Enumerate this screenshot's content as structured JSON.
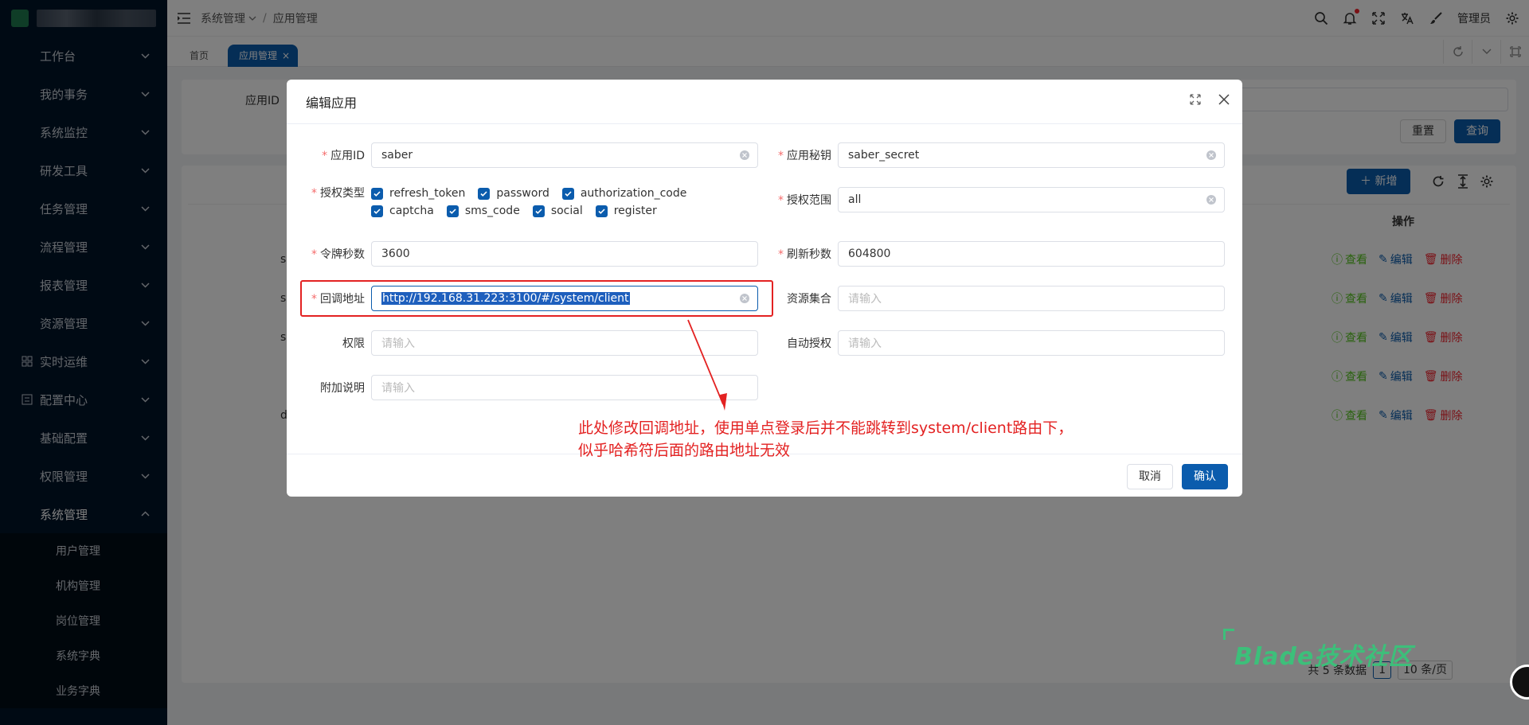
{
  "sidebar": {
    "items": [
      {
        "label": "工作台"
      },
      {
        "label": "我的事务"
      },
      {
        "label": "系统监控"
      },
      {
        "label": "研发工具"
      },
      {
        "label": "任务管理"
      },
      {
        "label": "流程管理"
      },
      {
        "label": "报表管理"
      },
      {
        "label": "资源管理"
      },
      {
        "label": "实时运维"
      },
      {
        "label": "配置中心"
      },
      {
        "label": "基础配置"
      },
      {
        "label": "权限管理"
      },
      {
        "label": "系统管理"
      }
    ],
    "sub_items": [
      "用户管理",
      "机构管理",
      "岗位管理",
      "系统字典",
      "业务字典"
    ]
  },
  "topbar": {
    "breadcrumb": [
      "系统管理",
      "应用管理"
    ],
    "user": "管理员"
  },
  "tabs": [
    "首页",
    "应用管理"
  ],
  "search": {
    "app_id_label": "应用ID",
    "reset_label": "重置",
    "query_label": "查询"
  },
  "toolbar": {
    "add_label": "新增"
  },
  "table": {
    "op_header": "操作",
    "row_first_chars": [
      "s",
      "s",
      "s",
      "",
      "d"
    ],
    "actions": {
      "view": "查看",
      "edit": "编辑",
      "delete": "删除"
    }
  },
  "pagination": {
    "total": "共 5 条数据",
    "page": "1",
    "size": "10 条/页"
  },
  "watermark": "Blade技术社区",
  "dialog": {
    "title": "编辑应用",
    "fields": {
      "client_id": {
        "label": "应用ID",
        "value": "saber"
      },
      "client_secret": {
        "label": "应用秘钥",
        "value": "saber_secret"
      },
      "grant_types": {
        "label": "授权类型",
        "options": [
          "refresh_token",
          "password",
          "authorization_code",
          "captcha",
          "sms_code",
          "social",
          "register"
        ]
      },
      "scope": {
        "label": "授权范围",
        "value": "all"
      },
      "access_token_validity": {
        "label": "令牌秒数",
        "value": "3600"
      },
      "refresh_token_validity": {
        "label": "刷新秒数",
        "value": "604800"
      },
      "redirect_uri": {
        "label": "回调地址",
        "value": "http://192.168.31.223:3100/#/system/client"
      },
      "resource_ids": {
        "label": "资源集合",
        "placeholder": "请输入"
      },
      "authorities": {
        "label": "权限",
        "placeholder": "请输入"
      },
      "auto_approve": {
        "label": "自动授权",
        "placeholder": "请输入"
      },
      "additional_info": {
        "label": "附加说明",
        "placeholder": "请输入"
      }
    },
    "cancel_label": "取消",
    "confirm_label": "确认"
  },
  "annotation": {
    "line1": "此处修改回调地址，使用单点登录后并不能跳转到system/client路由下，",
    "line2": "似乎哈希符后面的路由地址无效"
  },
  "colors": {
    "primary": "#0b5cad",
    "sidebar": "#001529",
    "annotation": "#e32222"
  }
}
